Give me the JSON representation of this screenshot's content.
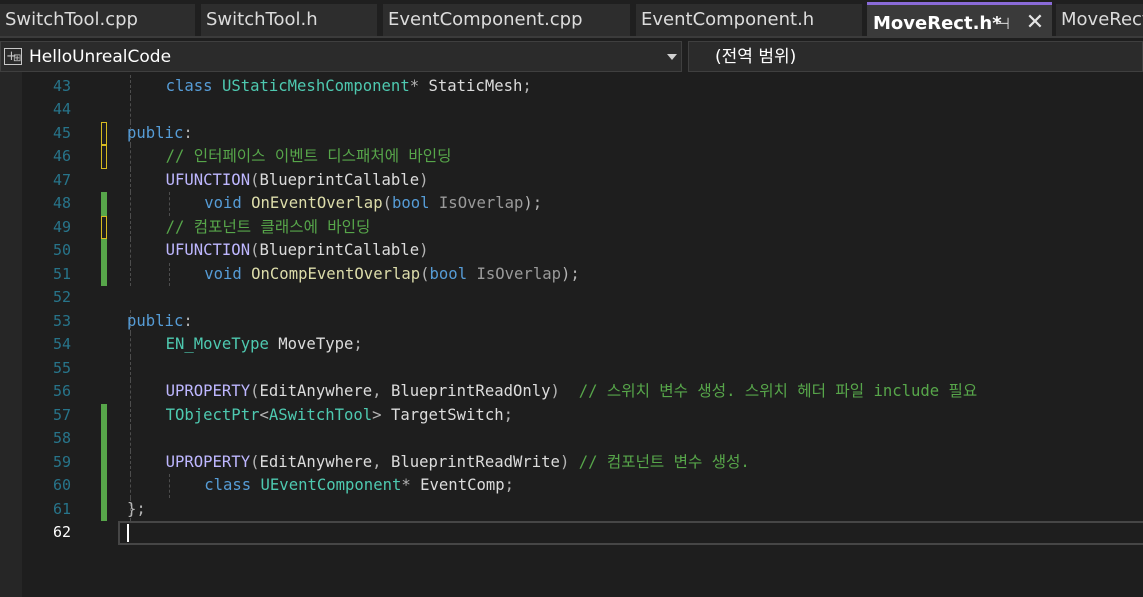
{
  "tabs": [
    {
      "label": "SwitchTool.cpp",
      "active": false
    },
    {
      "label": "SwitchTool.h",
      "active": false
    },
    {
      "label": "EventComponent.cpp",
      "active": false
    },
    {
      "label": "EventComponent.h",
      "active": false
    },
    {
      "label": "MoveRect.h*",
      "active": true,
      "pin_glyph": "⊣",
      "close_glyph": "✕"
    },
    {
      "label": "MoveRect",
      "active": false
    }
  ],
  "navbar": {
    "project_icon": "class-view-icon",
    "project": "HelloUnrealCode",
    "scope": "(전역 범위)"
  },
  "colors": {
    "accent": "#8a6bd8",
    "keyword": "#569cd6",
    "type": "#4ec9b0",
    "function": "#dcdcaa",
    "macro": "#beb7ff",
    "comment": "#57a64a",
    "line_number": "#2b91af",
    "change_saved": "#57a64a",
    "change_unsaved": "#d7ba20"
  },
  "editor": {
    "current_line": 62,
    "lines": [
      {
        "n": "43",
        "change": "none",
        "tokens": [
          [
            "kw",
            "class"
          ],
          [
            "tx",
            " "
          ],
          [
            "ty",
            "UStaticMeshComponent"
          ],
          [
            "pn",
            "* "
          ],
          [
            "tx",
            "StaticMesh"
          ],
          [
            "pn",
            ";"
          ]
        ]
      },
      {
        "n": "44",
        "change": "none",
        "tokens": []
      },
      {
        "n": "45",
        "change": "unsaved",
        "tokens": [
          [
            "kw",
            "public"
          ],
          [
            "pn",
            ":"
          ]
        ]
      },
      {
        "n": "46",
        "change": "unsaved",
        "tokens": [
          [
            "cm",
            "// 인터페이스 이벤트 디스패처에 바인딩"
          ]
        ]
      },
      {
        "n": "47",
        "change": "none",
        "tokens": [
          [
            "mac",
            "UFUNCTION"
          ],
          [
            "pn",
            "("
          ],
          [
            "tx",
            "BlueprintCallable"
          ],
          [
            "pn",
            ")"
          ]
        ]
      },
      {
        "n": "48",
        "change": "saved",
        "tokens": [
          [
            "kw",
            "void"
          ],
          [
            "tx",
            " "
          ],
          [
            "fn",
            "OnEventOverlap"
          ],
          [
            "pn",
            "("
          ],
          [
            "kw",
            "bool"
          ],
          [
            "tx",
            " "
          ],
          [
            "pr",
            "IsOverlap"
          ],
          [
            "pn",
            ");"
          ]
        ]
      },
      {
        "n": "49",
        "change": "unsaved",
        "tokens": [
          [
            "cm",
            "// 컴포넌트 클래스에 바인딩"
          ]
        ]
      },
      {
        "n": "50",
        "change": "saved",
        "tokens": [
          [
            "mac",
            "UFUNCTION"
          ],
          [
            "pn",
            "("
          ],
          [
            "tx",
            "BlueprintCallable"
          ],
          [
            "pn",
            ")"
          ]
        ]
      },
      {
        "n": "51",
        "change": "saved",
        "tokens": [
          [
            "kw",
            "void"
          ],
          [
            "tx",
            " "
          ],
          [
            "fn",
            "OnCompEventOverlap"
          ],
          [
            "pn",
            "("
          ],
          [
            "kw",
            "bool"
          ],
          [
            "tx",
            " "
          ],
          [
            "pr",
            "IsOverlap"
          ],
          [
            "pn",
            ");"
          ]
        ]
      },
      {
        "n": "52",
        "change": "none",
        "tokens": []
      },
      {
        "n": "53",
        "change": "none",
        "tokens": [
          [
            "kw",
            "public"
          ],
          [
            "pn",
            ":"
          ]
        ]
      },
      {
        "n": "54",
        "change": "none",
        "tokens": [
          [
            "ty",
            "EN_MoveType"
          ],
          [
            "tx",
            " MoveType"
          ],
          [
            "pn",
            ";"
          ]
        ]
      },
      {
        "n": "55",
        "change": "none",
        "tokens": []
      },
      {
        "n": "56",
        "change": "none",
        "tokens": [
          [
            "mac",
            "UPROPERTY"
          ],
          [
            "pn",
            "("
          ],
          [
            "tx",
            "EditAnywhere"
          ],
          [
            "pn",
            ", "
          ],
          [
            "tx",
            "BlueprintReadOnly"
          ],
          [
            "pn",
            ")"
          ],
          [
            "tx",
            "  "
          ],
          [
            "cm",
            "// 스위치 변수 생성. 스위치 헤더 파일 include 필요"
          ]
        ]
      },
      {
        "n": "57",
        "change": "saved",
        "tokens": [
          [
            "ty",
            "TObjectPtr"
          ],
          [
            "pn",
            "<"
          ],
          [
            "ty",
            "ASwitchTool"
          ],
          [
            "pn",
            "> "
          ],
          [
            "tx",
            "TargetSwitch"
          ],
          [
            "pn",
            ";"
          ]
        ]
      },
      {
        "n": "58",
        "change": "saved",
        "tokens": []
      },
      {
        "n": "59",
        "change": "saved",
        "tokens": [
          [
            "mac",
            "UPROPERTY"
          ],
          [
            "pn",
            "("
          ],
          [
            "tx",
            "EditAnywhere"
          ],
          [
            "pn",
            ", "
          ],
          [
            "tx",
            "BlueprintReadWrite"
          ],
          [
            "pn",
            ")"
          ],
          [
            "tx",
            " "
          ],
          [
            "cm",
            "// 컴포넌트 변수 생성."
          ]
        ]
      },
      {
        "n": "60",
        "change": "saved",
        "tokens": [
          [
            "kw",
            "class"
          ],
          [
            "tx",
            " "
          ],
          [
            "ty",
            "UEventComponent"
          ],
          [
            "pn",
            "* "
          ],
          [
            "tx",
            "EventComp"
          ],
          [
            "pn",
            ";"
          ]
        ]
      },
      {
        "n": "61",
        "change": "saved",
        "tokens": [
          [
            "pn",
            "};"
          ]
        ]
      },
      {
        "n": "62",
        "change": "none",
        "tokens": []
      }
    ]
  }
}
